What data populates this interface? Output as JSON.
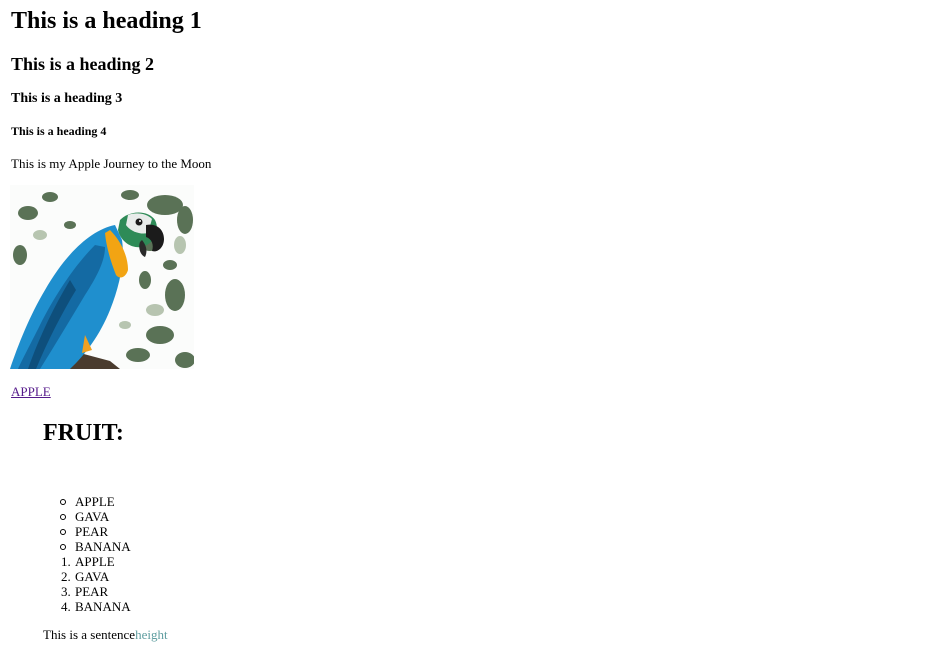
{
  "headings": {
    "h1": "This is a heading 1",
    "h2": "This is a heading 2",
    "h3": "This is a heading 3",
    "h4": "This is a heading 4"
  },
  "paragraph": "This is my Apple Journey to the Moon",
  "image": {
    "subject": "macaw-parrot",
    "description_icon": "parrot-image"
  },
  "link": {
    "label": "APPLE",
    "color": "#551a8b"
  },
  "fruit_heading": "FRUIT:",
  "unordered_list": [
    "APPLE",
    "GAVA",
    "PEAR",
    "BANANA"
  ],
  "ordered_list": [
    {
      "number": "1.",
      "label": "APPLE"
    },
    {
      "number": "2.",
      "label": "GAVA"
    },
    {
      "number": "3.",
      "label": "PEAR"
    },
    {
      "number": "4.",
      "label": "BANANA"
    }
  ],
  "sentence": {
    "text": "This is a sentence",
    "accent_text": "height",
    "accent_color": "#5f9ea0"
  }
}
